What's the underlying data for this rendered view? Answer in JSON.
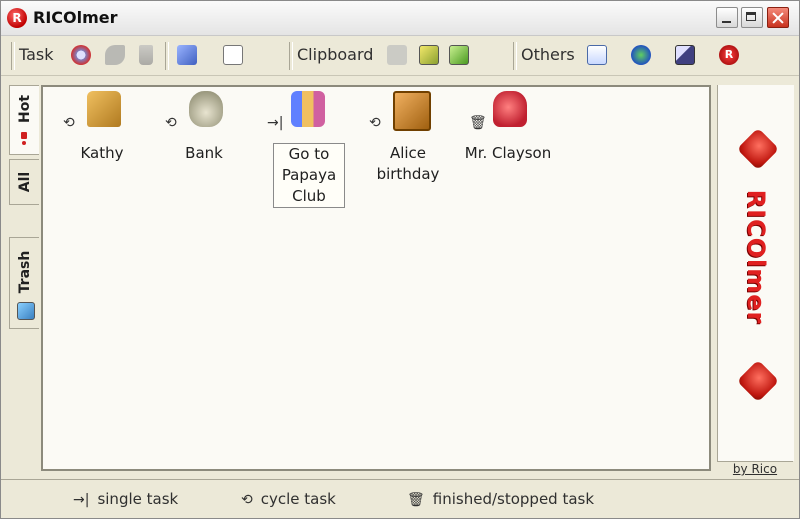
{
  "window": {
    "title": "RICOlmer",
    "app_icon_letter": "R"
  },
  "toolbar": {
    "task_label": "Task",
    "clipboard_label": "Clipboard",
    "others_label": "Others"
  },
  "tabs": [
    {
      "label": "Hot"
    },
    {
      "label": "All"
    },
    {
      "label": "Trash"
    }
  ],
  "tasks": [
    {
      "label": "Kathy",
      "indicator": "cycle task",
      "indicator_glyph": "⟲",
      "icon": "box-icon"
    },
    {
      "label": "Bank",
      "indicator": "cycle task",
      "indicator_glyph": "⟲",
      "icon": "money-bag-icon"
    },
    {
      "label": "Go to Papaya Club",
      "indicator": "single task",
      "indicator_glyph": "→|",
      "icon": "drinks-icon",
      "selected": true
    },
    {
      "label": "Alice birthday",
      "indicator": "cycle task",
      "indicator_glyph": "⟲",
      "icon": "gift-box-icon"
    },
    {
      "label": "Mr. Clayson",
      "indicator": "finished/stopped task",
      "indicator_glyph": "🗑",
      "icon": "telephone-icon"
    }
  ],
  "side": {
    "brand": "RICOlmer",
    "credit": "by Rico"
  },
  "legend": {
    "single_task": "single task",
    "cycle_task": "cycle task",
    "finished_task": "finished/stopped task",
    "single_glyph": "→|",
    "cycle_glyph": "⟲",
    "finished_glyph": "🗑"
  }
}
